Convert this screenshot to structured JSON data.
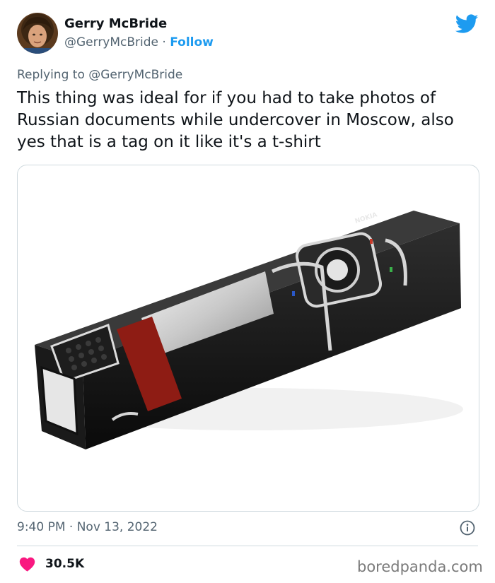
{
  "author": {
    "name": "Gerry McBride",
    "handle": "@GerryMcBride",
    "separator": " · ",
    "follow_label": "Follow"
  },
  "reply": {
    "prefix": "Replying to ",
    "handle": "@GerryMcBride"
  },
  "tweet": {
    "text": "This thing was ideal for if you had to take photos of Russian documents while undercover in Moscow, also yes that is a tag on it like it's a t-shirt"
  },
  "media": {
    "brand_text": "NOKIA"
  },
  "meta": {
    "timestamp": "9:40 PM · Nov 13, 2022"
  },
  "stats": {
    "likes": "30.5K"
  },
  "watermark": "boredpanda.com",
  "colors": {
    "accent": "#1d9bf0",
    "heart": "#f91880",
    "secondary_text": "#536471",
    "border": "#cfd9de"
  },
  "icons": {
    "logo": "twitter-bird-icon",
    "info": "info-icon",
    "like": "heart-icon"
  }
}
